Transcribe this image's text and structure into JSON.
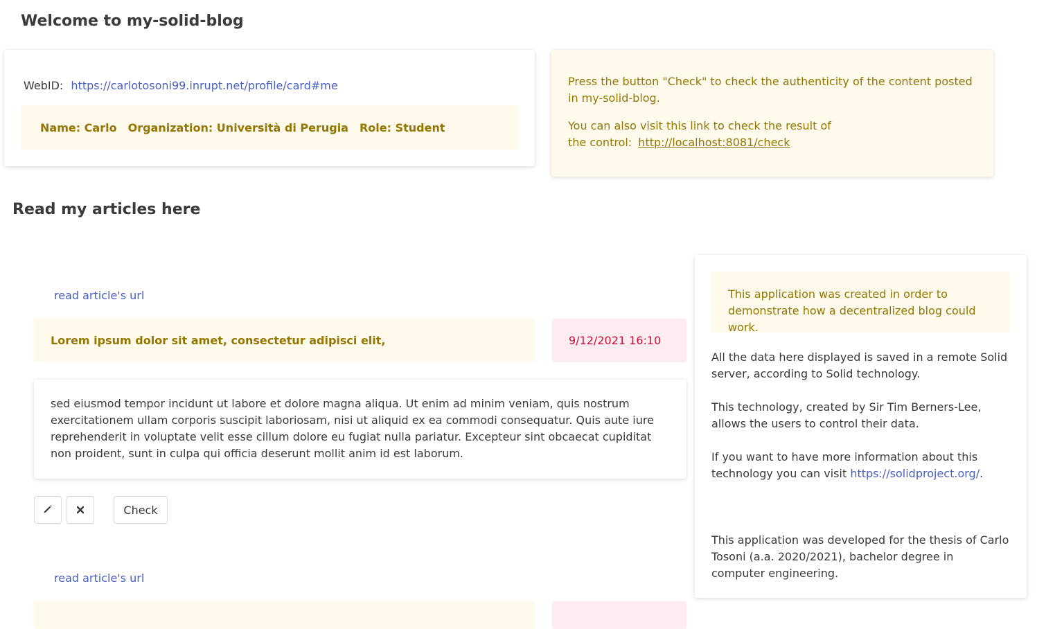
{
  "header": {
    "title": "Welcome to my-solid-blog"
  },
  "profile": {
    "webid_label": "WebID:",
    "webid_url": "https://carlotosoni99.inrupt.net/profile/card#me",
    "name": "Name: Carlo",
    "organization": "Organization: Università di Perugia",
    "role": "Role: Student"
  },
  "check_notice": {
    "line1": "Press the button \"Check\" to check the authenticity of the content posted in my-solid-blog.",
    "line2_prefix": "You can also visit this link to check the result of the control:",
    "link": "http://localhost:8081/check"
  },
  "articles_section": {
    "title": "Read my articles here"
  },
  "articles": [
    {
      "url_label": "read article's url",
      "title": "Lorem ipsum dolor sit amet, consectetur adipisci elit,",
      "date": "9/12/2021 16:10",
      "body": "sed eiusmod tempor incidunt ut labore et dolore magna aliqua. Ut enim ad minim veniam, quis nostrum exercitationem ullam corporis suscipit laboriosam, nisi ut aliquid ex ea commodi consequatur. Quis aute iure reprehenderit in voluptate velit esse cillum dolore eu fugiat nulla pariatur. Excepteur sint obcaecat cupiditat non proident, sunt in culpa qui officia deserunt mollit anim id est laborum.",
      "check_label": "Check"
    },
    {
      "url_label": "read article's url"
    }
  ],
  "sidebar": {
    "notice": "This application was created in order to demonstrate how a decentralized blog could work.",
    "p1": "All the data here displayed is saved in a remote Solid server, according to Solid technology.",
    "p2": "This technology, created by Sir Tim Berners-Lee, allows the users to control their data.",
    "p3_prefix": "If you want to have more information about this technology you can visit",
    "p3_link": "https://solidproject.org/",
    "p3_suffix": ".",
    "p4": "This application was developed for the thesis of Carlo Tosoni (a.a. 2020/2021), bachelor degree in computer engineering."
  },
  "colors": {
    "link": "#485fc7",
    "warning_bg": "#fffaeb",
    "warning_text": "#947600",
    "danger_bg": "#feecf0",
    "danger_text": "#cc0f35"
  },
  "icons": {
    "edit": "pencil-icon",
    "delete": "close-icon"
  }
}
